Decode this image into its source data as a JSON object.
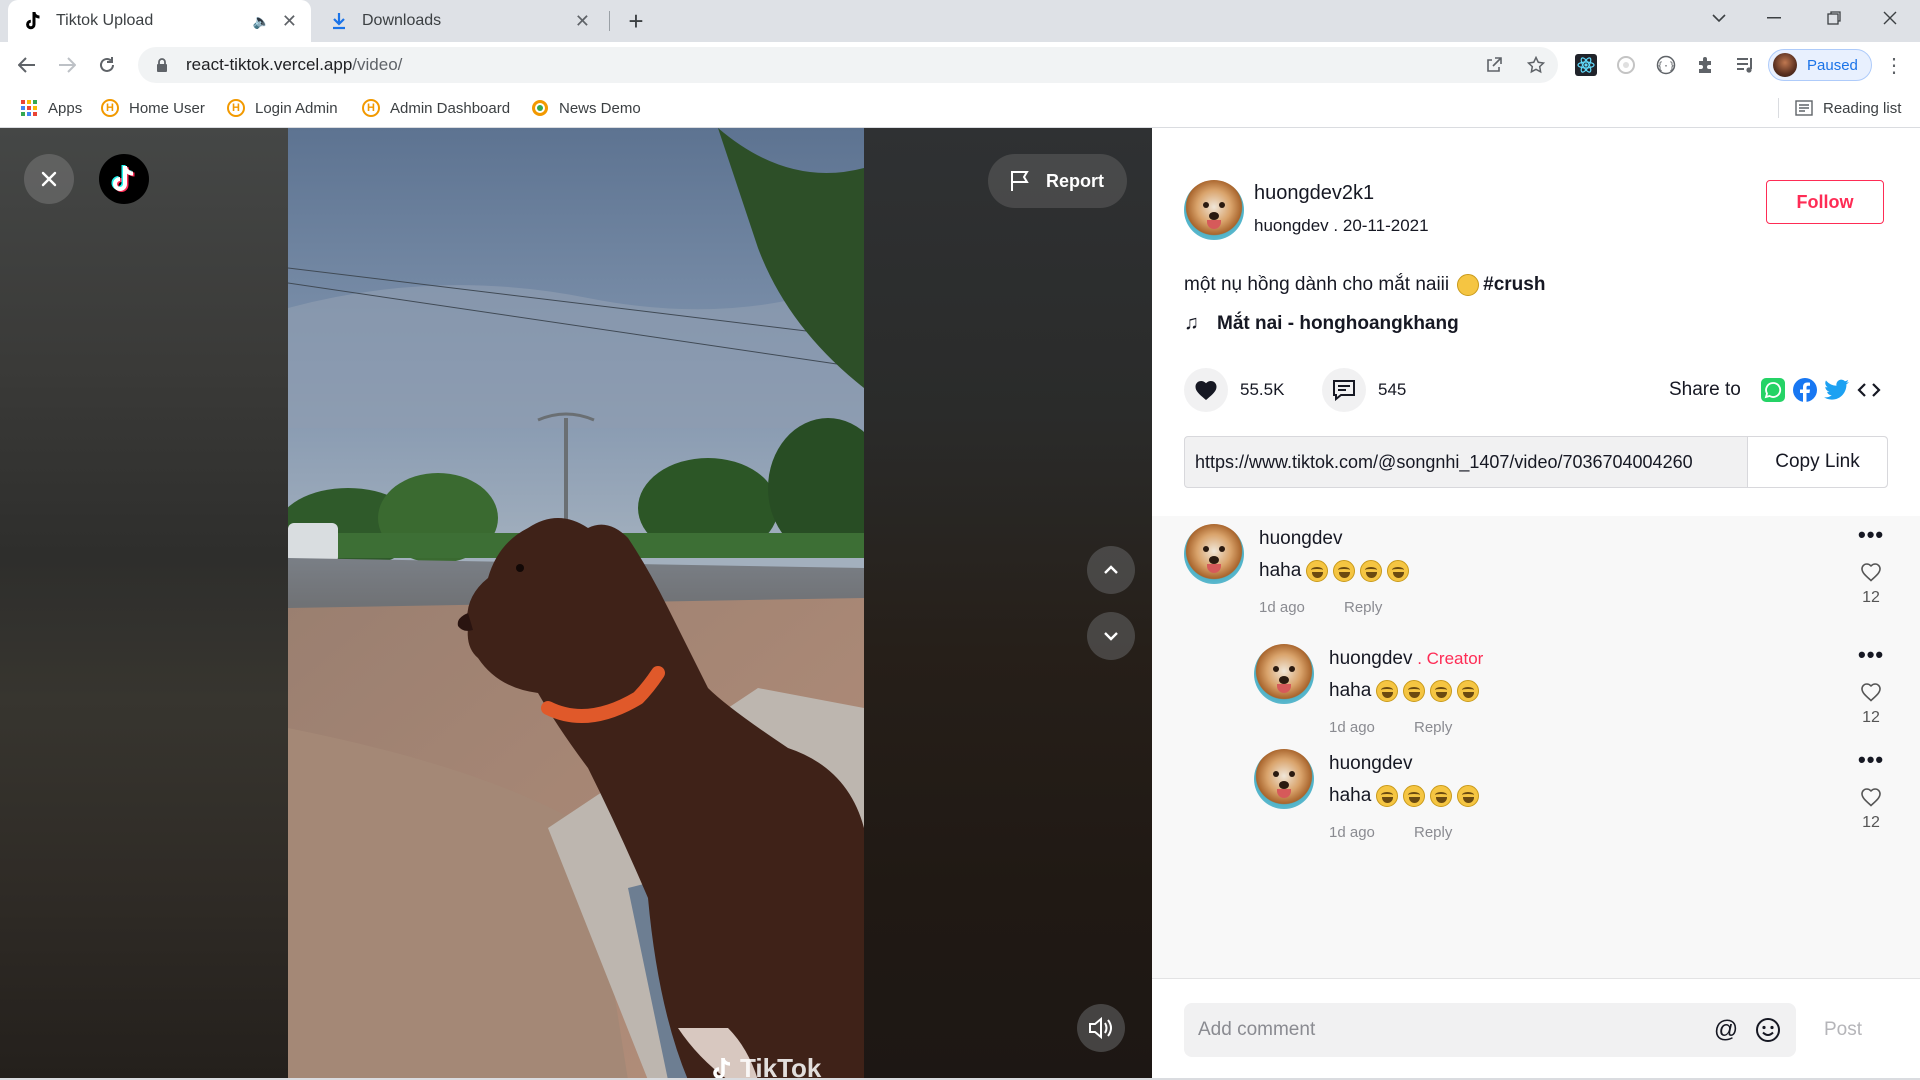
{
  "browser": {
    "tabs": [
      {
        "title": "Tiktok Upload",
        "active": true
      },
      {
        "title": "Downloads",
        "active": false
      }
    ],
    "url": {
      "host": "react-tiktok.vercel.app",
      "path": "/video/"
    },
    "profile_status": "Paused",
    "bookmarks": [
      "Apps",
      "Home User",
      "Login Admin",
      "Admin Dashboard",
      "News Demo"
    ],
    "reading_list": "Reading list"
  },
  "video": {
    "report_label": "Report",
    "watermark": "TikTok"
  },
  "post": {
    "username": "huongdev2k1",
    "display_name": "huongdev",
    "date": "20-11-2021",
    "follow_label": "Follow",
    "caption": "một nụ hồng dành cho mắt naiii",
    "hashtag": "#crush",
    "music": "Mắt nai - honghoangkhang",
    "likes": "55.5K",
    "comments_count": "545",
    "share_label": "Share to",
    "link": "https://www.tiktok.com/@songnhi_1407/video/7036704004260",
    "copy_label": "Copy Link"
  },
  "comments": [
    {
      "name": "huongdev",
      "creator": "",
      "text": "haha",
      "time": "1d ago",
      "reply": "Reply",
      "likes": "12"
    },
    {
      "name": "huongdev",
      "creator": "Creator",
      "text": "haha",
      "time": "1d ago",
      "reply": "Reply",
      "likes": "12"
    },
    {
      "name": "huongdev",
      "creator": "",
      "text": "haha",
      "time": "1d ago",
      "reply": "Reply",
      "likes": "12"
    }
  ],
  "composer": {
    "placeholder": "Add comment",
    "post_label": "Post"
  },
  "colors": {
    "accent": "#fe2c55",
    "text": "#161823",
    "muted": "#8a8b91"
  }
}
